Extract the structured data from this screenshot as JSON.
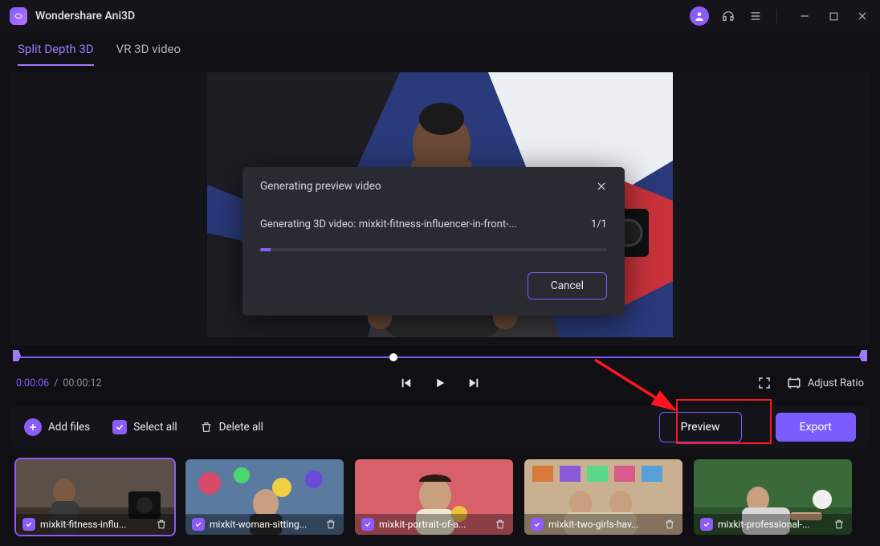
{
  "app": {
    "title": "Wondershare Ani3D"
  },
  "tabs": {
    "split": "Split Depth 3D",
    "vr": "VR 3D video"
  },
  "time": {
    "current": "0:00:06",
    "total": "00:00:12"
  },
  "ratio": {
    "label": "Adjust Ratio"
  },
  "toolbar": {
    "add": "Add files",
    "select_all": "Select all",
    "delete_all": "Delete all",
    "preview": "Preview",
    "export": "Export"
  },
  "dialog": {
    "title": "Generating preview video",
    "message": "Generating 3D video: mixkit-fitness-influencer-in-front-...",
    "counter": "1/1",
    "cancel": "Cancel"
  },
  "thumbs": [
    {
      "name": "mixkit-fitness-influ..."
    },
    {
      "name": "mixkit-woman-sitting..."
    },
    {
      "name": "mixkit-portrait-of-a..."
    },
    {
      "name": "mixkit-two-girls-hav..."
    },
    {
      "name": "mixkit-professional-..."
    }
  ]
}
